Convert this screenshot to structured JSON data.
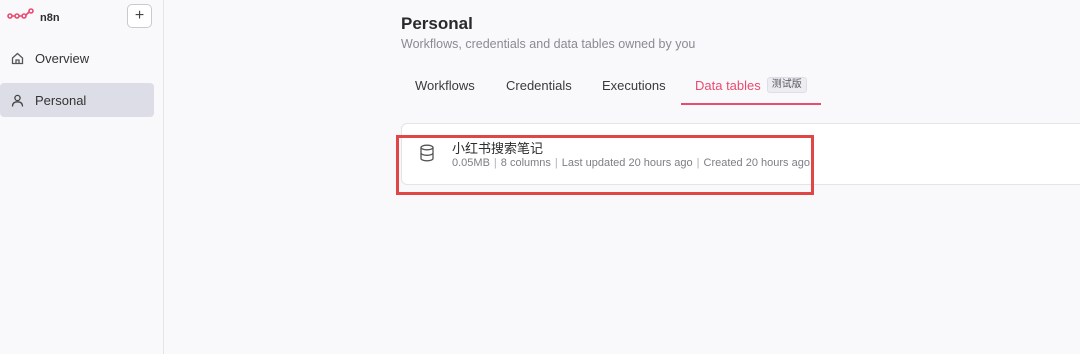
{
  "app": {
    "name": "n8n"
  },
  "sidebar": {
    "add_label": "+",
    "items": [
      {
        "label": "Overview",
        "icon": "home-icon",
        "active": false
      },
      {
        "label": "Personal",
        "icon": "user-icon",
        "active": true
      }
    ]
  },
  "header": {
    "title": "Personal",
    "subtitle": "Workflows, credentials and data tables owned by you"
  },
  "tabs": [
    {
      "label": "Workflows"
    },
    {
      "label": "Credentials"
    },
    {
      "label": "Executions"
    },
    {
      "label": "Data tables",
      "badge": "测试版",
      "active": true
    }
  ],
  "data_tables": [
    {
      "name": "小红书搜索笔记",
      "size": "0.05MB",
      "columns": "8 columns",
      "updated": "Last updated 20 hours ago",
      "created": "Created 20 hours ago",
      "icon": "database-icon"
    }
  ],
  "colors": {
    "accent": "#ea4b71",
    "highlight_box": "#e04646",
    "sidebar_active": "#dcdde6"
  }
}
